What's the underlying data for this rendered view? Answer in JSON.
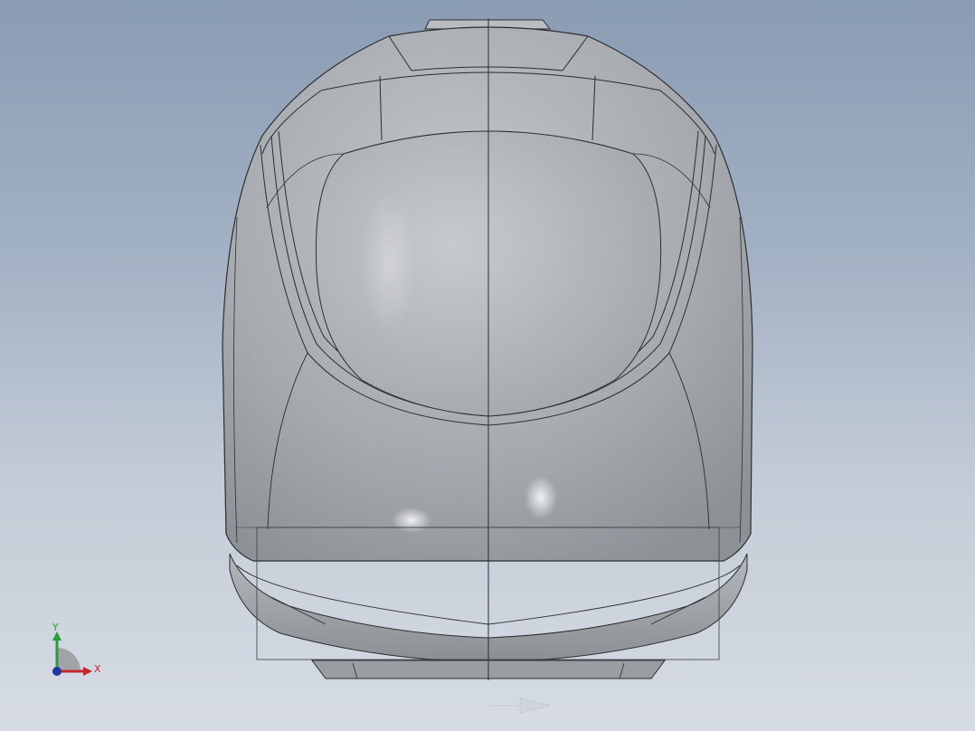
{
  "viewport": {
    "background_top": "#8a9cb3",
    "background_bottom": "#d7dce4"
  },
  "model": {
    "body_color": "#a8acb1",
    "edge_color": "#2b2d30"
  },
  "triad": {
    "x_label": "X",
    "y_label": "Y",
    "x_color": "#c0282d",
    "y_color": "#2a9c3a",
    "z_color": "#1f3a9c",
    "icon": "coordinate-triad-icon"
  }
}
